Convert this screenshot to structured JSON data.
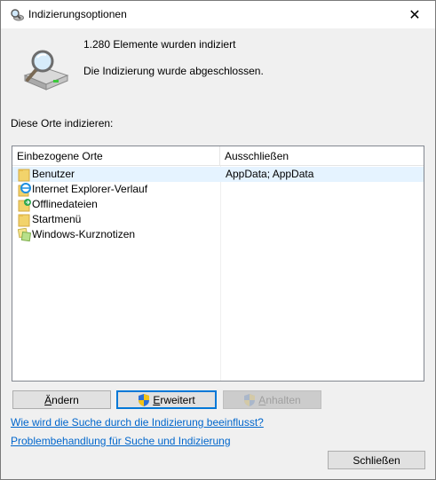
{
  "window": {
    "title": "Indizierungsoptionen",
    "close_glyph": "✕"
  },
  "status": {
    "count_text": "1.280 Elemente wurden indiziert",
    "state_text": "Die Indizierung wurde abgeschlossen."
  },
  "locations": {
    "section_label": "Diese Orte indizieren:",
    "columns": [
      "Einbezogene Orte",
      "Ausschließen"
    ],
    "rows": [
      {
        "label": "Benutzer",
        "exclude": "AppData; AppData",
        "icon": "folder-icon",
        "selected": true
      },
      {
        "label": "Internet Explorer-Verlauf",
        "exclude": "",
        "icon": "internet-explorer-icon",
        "selected": false
      },
      {
        "label": "Offlinedateien",
        "exclude": "",
        "icon": "offline-files-icon",
        "selected": false
      },
      {
        "label": "Startmenü",
        "exclude": "",
        "icon": "folder-icon",
        "selected": false
      },
      {
        "label": "Windows-Kurznotizen",
        "exclude": "",
        "icon": "sticky-notes-icon",
        "selected": false
      }
    ]
  },
  "buttons": {
    "change_pre": "",
    "change_key": "Ä",
    "change_post": "ndern",
    "advanced_pre": "",
    "advanced_key": "E",
    "advanced_post": "rweitert",
    "pause_pre": "",
    "pause_key": "A",
    "pause_post": "nhalten",
    "close": "Schließen"
  },
  "links": {
    "how_search": "Wie wird die Suche durch die Indizierung beeinflusst?",
    "troubleshoot": "Problembehandlung für Suche und Indizierung"
  },
  "colors": {
    "accent": "#0078d7",
    "link": "#0066cc",
    "selected_row": "#e5f3ff"
  }
}
